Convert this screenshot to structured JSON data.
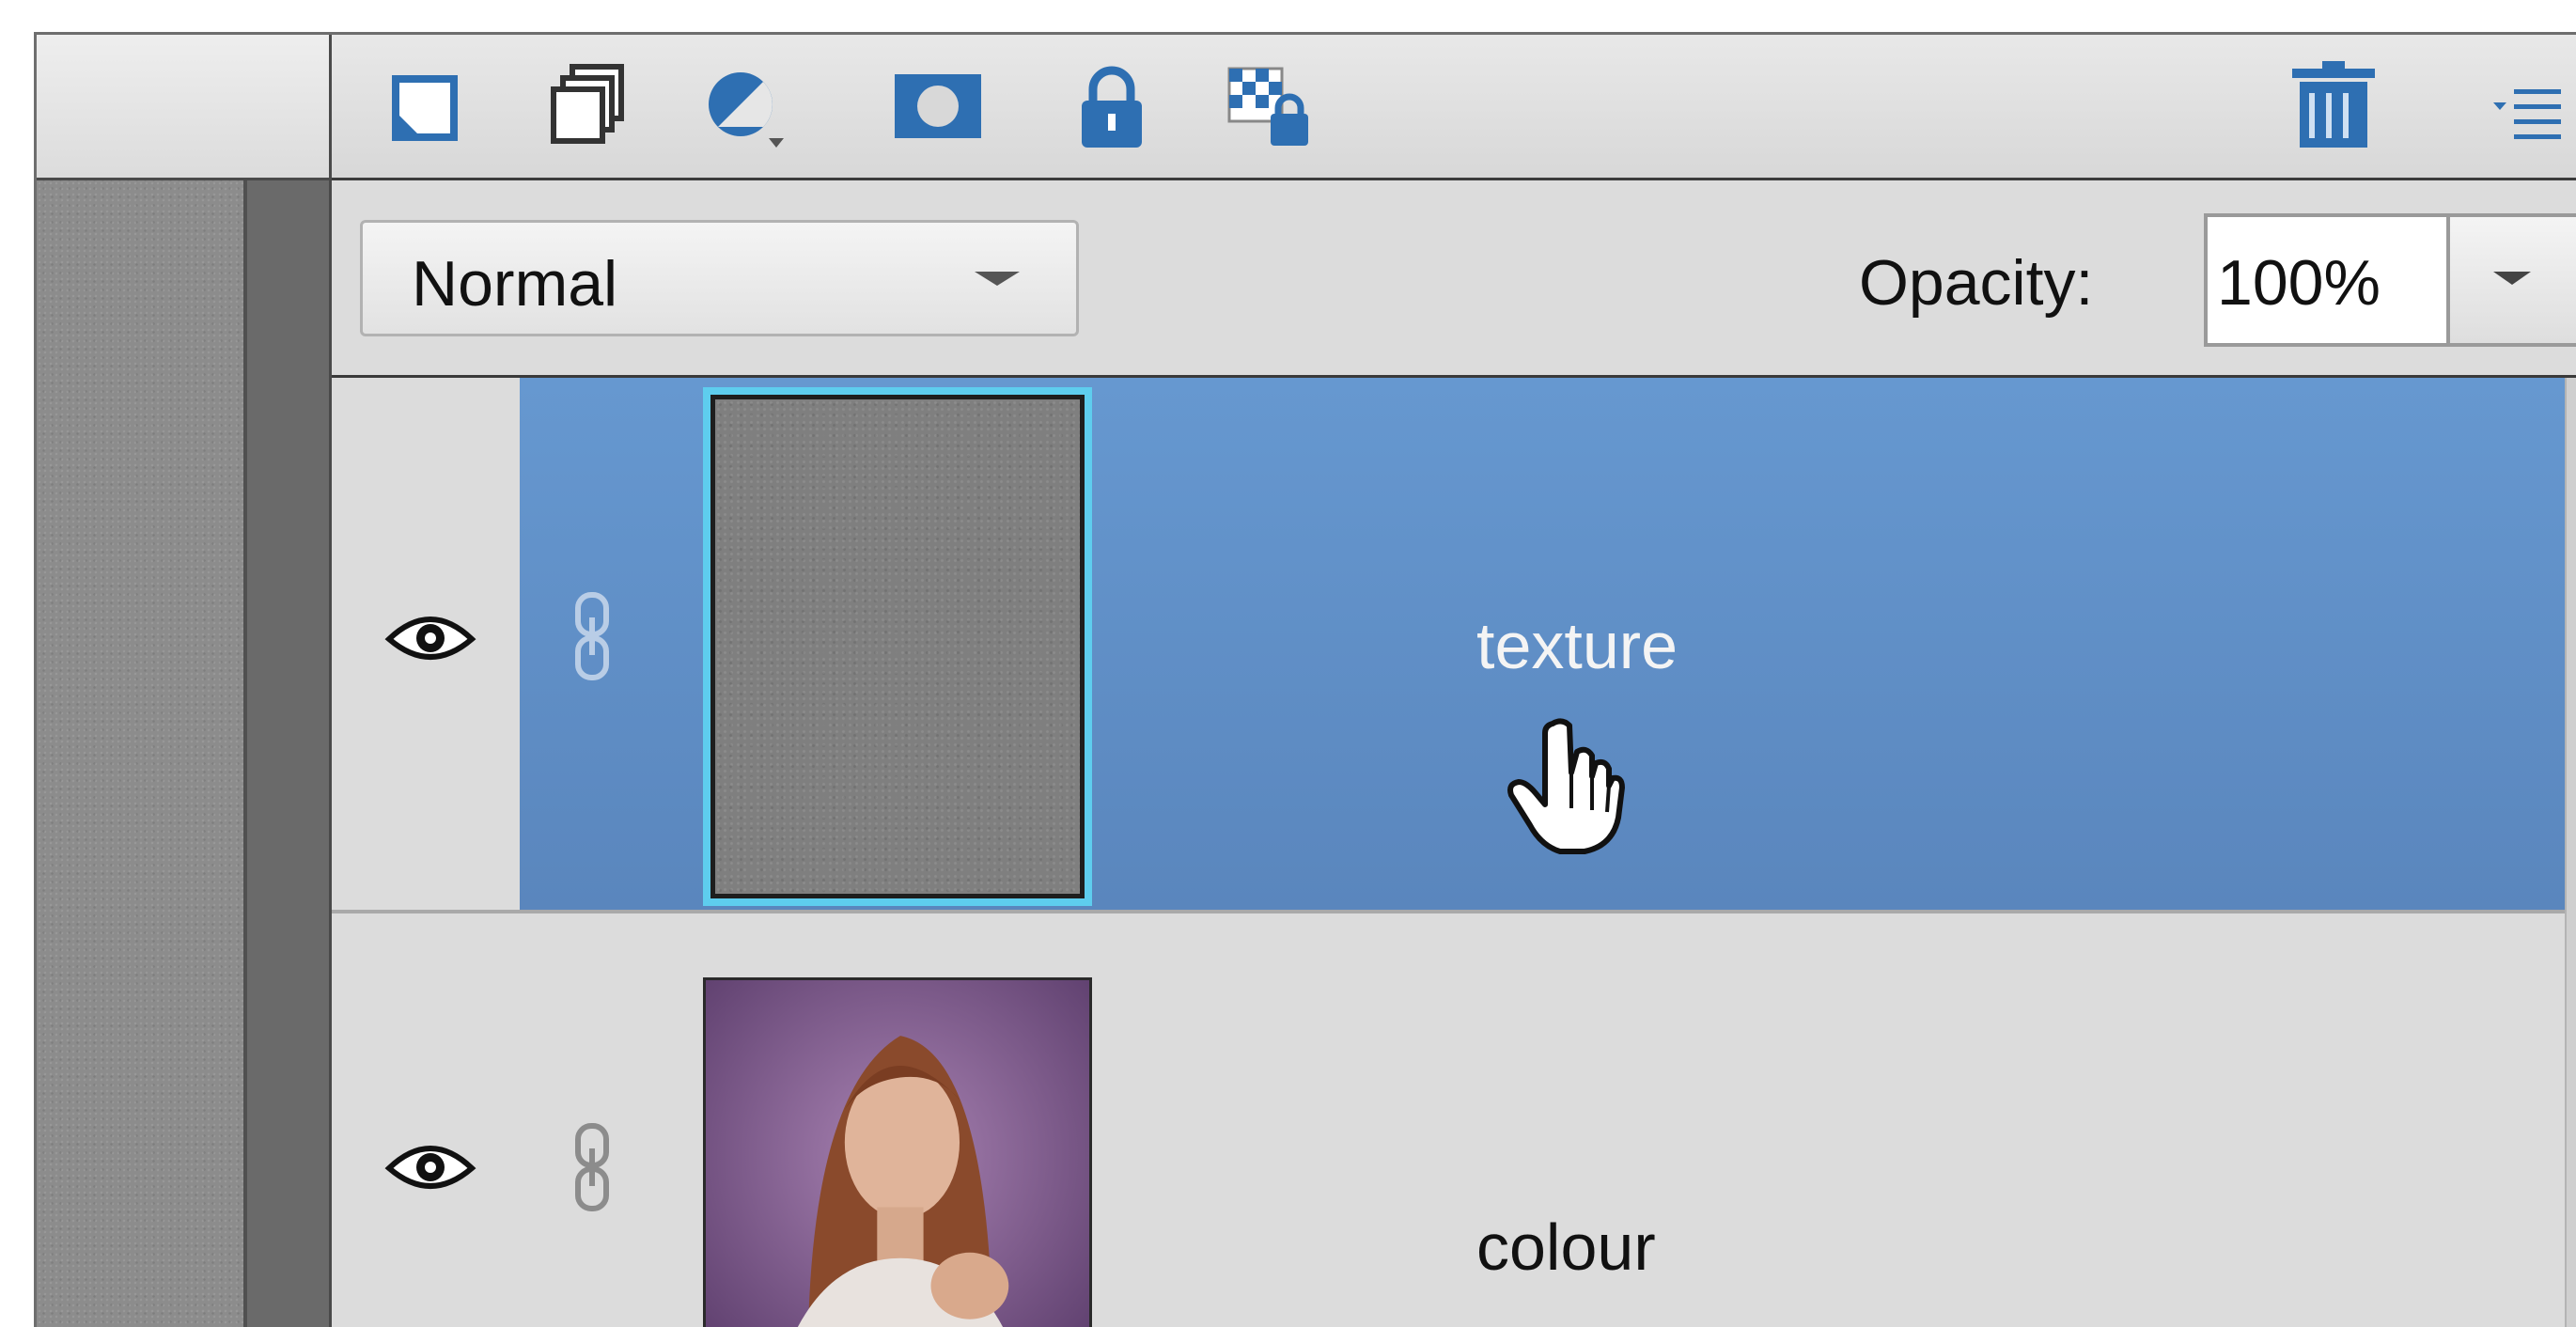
{
  "toolbar": {
    "icons": [
      "new-layer-icon",
      "new-group-icon",
      "adjustment-layer-icon",
      "add-mask-icon",
      "lock-all-icon",
      "lock-transparent-icon",
      "delete-layer-icon",
      "panel-menu-icon"
    ]
  },
  "blend_mode": {
    "value": "Normal"
  },
  "opacity": {
    "label": "Opacity:",
    "value": "100%"
  },
  "layers": [
    {
      "name": "texture",
      "selected": true,
      "visible": true
    },
    {
      "name": "colour",
      "selected": false,
      "visible": true
    }
  ],
  "colors": {
    "selection": "#6698d0",
    "thumb_highlight": "#5ecdee",
    "icon_blue": "#2e6fb2"
  }
}
